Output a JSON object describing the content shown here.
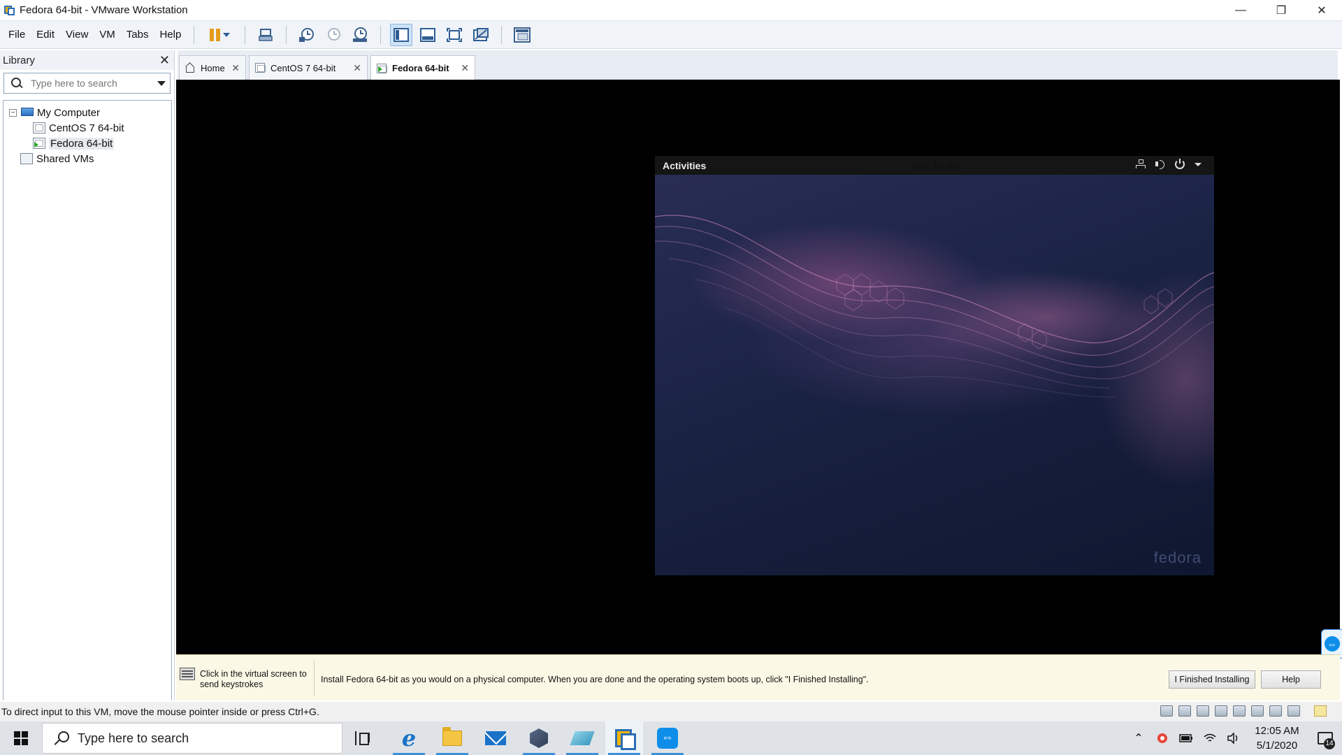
{
  "window": {
    "title": "Fedora 64-bit - VMware Workstation",
    "controls": {
      "minimize": "—",
      "restore": "❐",
      "close": "✕"
    }
  },
  "menu": {
    "items": [
      "File",
      "Edit",
      "View",
      "VM",
      "Tabs",
      "Help"
    ]
  },
  "toolbar": {
    "icons": [
      "pause-icon",
      "send-ctrl-alt-del-icon",
      "snapshot-icon",
      "revert-snapshot-icon",
      "snapshot-manager-icon",
      "show-library-icon",
      "thumbnail-bar-icon",
      "full-screen-icon",
      "unity-icon",
      "console-view-icon"
    ]
  },
  "library": {
    "title": "Library",
    "close": "✕",
    "search_placeholder": "Type here to search",
    "tree": {
      "root": {
        "label": "My Computer",
        "expander": "−"
      },
      "children": [
        {
          "label": "CentOS 7 64-bit",
          "running": false
        },
        {
          "label": "Fedora 64-bit",
          "running": true,
          "selected": true
        }
      ],
      "shared": {
        "label": "Shared VMs"
      }
    }
  },
  "tabs": [
    {
      "label": "Home",
      "close": "✕",
      "active": false
    },
    {
      "label": "CentOS 7 64-bit",
      "close": "✕",
      "active": false
    },
    {
      "label": "Fedora 64-bit",
      "close": "✕",
      "active": true
    }
  ],
  "guest": {
    "activities": "Activities",
    "clock": "Thu 14:35",
    "wallpaper_mark": "fedora",
    "tray_icons": [
      "network-icon",
      "volume-icon",
      "power-icon",
      "chevron-down-icon"
    ]
  },
  "hintbar": {
    "left_text_line1": "Click in the virtual screen to",
    "left_text_line2": "send keystrokes",
    "message": "Install Fedora 64-bit as you would on a physical computer. When you are done and the operating system boots up, click \"I Finished Installing\".",
    "finished_button": "I Finished Installing",
    "help_button": "Help"
  },
  "statusbar": {
    "text": "To direct input to this VM, move the mouse pointer inside or press Ctrl+G."
  },
  "taskbar": {
    "search_placeholder": "Type here to search",
    "apps": [
      "edge-icon",
      "file-explorer-icon",
      "mail-icon",
      "virtualbox-icon",
      "app-icon",
      "vmware-icon",
      "teamviewer-icon"
    ],
    "time": "12:05 AM",
    "date": "5/1/2020",
    "notification_count": "14",
    "colors": {
      "accent": "#3f8fd8"
    }
  }
}
